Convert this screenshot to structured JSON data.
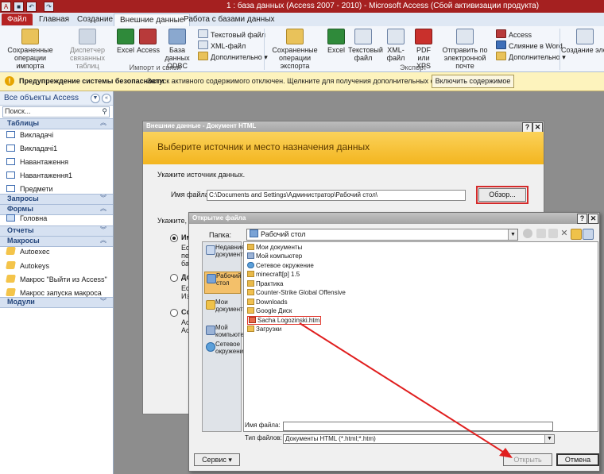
{
  "window": {
    "title": "1 : база данных (Access 2007 - 2010) - Microsoft Access (Сбой активизации продукта)"
  },
  "tabs": [
    "Файл",
    "Главная",
    "Создание",
    "Внешние данные",
    "Работа с базами данных"
  ],
  "ribbon": {
    "import": {
      "saved_ops": "Сохраненные операции импорта",
      "linked_tables": "Диспетчер связанных таблиц",
      "excel": "Excel",
      "access": "Access",
      "odbc": "База данных ODBC",
      "text_file": "Текстовый файл",
      "xml_file": "XML-файл",
      "more": "Дополнительно ▾",
      "group": "Импорт и связи"
    },
    "export": {
      "saved_ops": "Сохраненные операции экспорта",
      "excel": "Excel",
      "text_file": "Текстовый файл",
      "xml_file": "XML-файл",
      "pdf": "PDF или XPS",
      "email": "Отправить по электронной почте",
      "access": "Access",
      "word_merge": "Слияние в Word",
      "more": "Дополнительно ▾",
      "group": "Экспорт"
    },
    "collect": {
      "label": "Создание эле... сообще..."
    }
  },
  "security": {
    "title": "Предупреждение системы безопасности",
    "message": "Запуск активного содержимого отключен. Щелкните для получения дополнительных сведений.",
    "button": "Включить содержимое"
  },
  "nav": {
    "header": "Все объекты Access",
    "search_placeholder": "Поиск...",
    "sections": [
      {
        "title": "Таблицы",
        "items": [
          "Викладачі",
          "Викладачі1",
          "Навантаження",
          "Навантаження1",
          "Предмети"
        ]
      },
      {
        "title": "Запросы",
        "items": []
      },
      {
        "title": "Формы",
        "items": [
          "Головна"
        ]
      },
      {
        "title": "Отчеты",
        "items": []
      },
      {
        "title": "Макросы",
        "items": [
          "Autoexec",
          "Autokeys",
          "Макрос \"Выйти из Access\"",
          "Макрос запуска макроса"
        ]
      },
      {
        "title": "Модули",
        "items": []
      }
    ]
  },
  "dialog_html": {
    "title": "Внешние данные - Документ HTML",
    "heading": "Выберите источник и место назначения данных",
    "source_label": "Укажите источник данных.",
    "filename_label": "Имя файла:",
    "filename_value": "C:\\Documents and Settings\\Администратор\\Рабочий стол\\",
    "browse": "Обзор...",
    "specify": "Укажите, к",
    "opt1_short": "Им",
    "opt1_lines": [
      "Ес",
      "пе",
      "ба"
    ],
    "opt2_short": "До",
    "opt2_lines": [
      "Ес",
      "Из"
    ],
    "opt3_short": "Со",
    "opt3_lines": [
      "Ac",
      "Ac"
    ]
  },
  "dialog_open": {
    "title": "Открытие файла",
    "folder_label": "Папка:",
    "folder_value": "Рабочий стол",
    "places": [
      "Недавние документы",
      "Рабочий стол",
      "Мои документы",
      "Мой компьютер",
      "Сетевое окружение"
    ],
    "files": [
      "Мои документы",
      "Мой компьютер",
      "Сетевое окружение",
      "minecraft[p] 1.5",
      "Практика",
      "Counter-Strike Global Offensive",
      "Downloads",
      "Google Диск",
      "Sacha Logozinski.htm",
      "Загрузки"
    ],
    "filename_label": "Имя файла:",
    "filename_value": "",
    "filetype_label": "Тип файлов:",
    "filetype_value": "Документы HTML (*.html;*.htm)",
    "tools": "Сервис",
    "open": "Открыть",
    "cancel": "Отмена"
  },
  "colors": {
    "title_red": "#a52020",
    "arrow_red": "#e01e1e",
    "banner": "#f3b51f"
  }
}
